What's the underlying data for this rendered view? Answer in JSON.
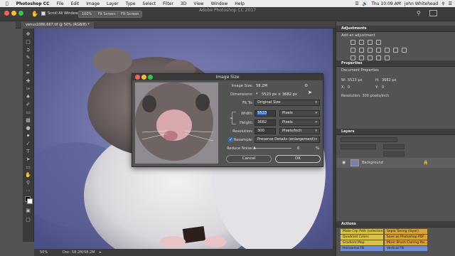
{
  "menubar": {
    "app_name": "Photoshop CC",
    "items": [
      "File",
      "Edit",
      "Image",
      "Layer",
      "Type",
      "Select",
      "Filter",
      "3D",
      "View",
      "Window",
      "Help"
    ],
    "time": "Thu 10:09 AM",
    "user": "john Whitehead"
  },
  "app_title": "Adobe Photoshop CC 2017",
  "options": {
    "scroll_all": "Scroll All Windows",
    "zoom": "100%",
    "fit_screen": "Fit Screen",
    "fill_screen": "Fill Screen"
  },
  "document": {
    "tab_label": "venus1086.667.tif @ 50% (RGB/8) *",
    "status_zoom": "50%",
    "status_doc": "Doc: 58.2M/58.2M"
  },
  "dialog": {
    "title": "Image Size",
    "image_size_label": "Image Size:",
    "image_size_value": "58.2M",
    "dimensions_label": "Dimensions:",
    "dimensions_value": "5523 px × 3682 px",
    "fit_to_label": "Fit To:",
    "fit_to_value": "Original Size",
    "width_label": "Width:",
    "width_value": "5523",
    "width_unit": "Pixels",
    "height_label": "Height:",
    "height_value": "3682",
    "height_unit": "Pixels",
    "resolution_label": "Resolution:",
    "resolution_value": "300",
    "resolution_unit": "Pixels/Inch",
    "resample_label": "Resample:",
    "resample_value": "Preserve Details (enlargement)",
    "reduce_noise_label": "Reduce Noise:",
    "reduce_noise_value": "0",
    "reduce_noise_unit": "%",
    "cancel": "Cancel",
    "ok": "OK"
  },
  "panels": {
    "adjustments_title": "Adjustments",
    "adjustments_sub": "Add an adjustment",
    "properties_title": "Properties",
    "properties_doc": "Document Properties",
    "w_label": "W:",
    "w_value": "5523 px",
    "h_label": "H:",
    "h_value": "3682 px",
    "x_label": "X:",
    "x_value": "0",
    "y_label": "Y:",
    "y_value": "0",
    "resolution": "Resolution: 300 pixels/inch",
    "layers_title": "Layers",
    "layer_name": "Background",
    "actions_title": "Actions",
    "actions": [
      {
        "label": "Make Clip Path (selection)",
        "color": "#d9c24a"
      },
      {
        "label": "Sepia Toning (layer)",
        "color": "#d9a437"
      },
      {
        "label": "Quadrant Colors",
        "color": "#d9c24a"
      },
      {
        "label": "Save as Photoshop PDF",
        "color": "#d9a437"
      },
      {
        "label": "Gradient Map",
        "color": "#d9c24a"
      },
      {
        "label": "Mixer Brush Cloning Pai...",
        "color": "#d9a437"
      },
      {
        "label": "Horizontal FB",
        "color": "#6d8fd1"
      },
      {
        "label": "Vertical FB",
        "color": "#6d8fd1"
      }
    ]
  },
  "colors": {
    "accent_blue": "#2d6ccf",
    "ok_border": "#8a8a8a"
  }
}
